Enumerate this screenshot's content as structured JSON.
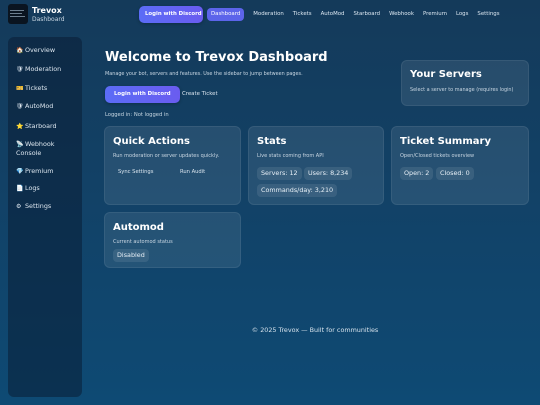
{
  "brand": {
    "title": "Trevox",
    "subtitle": "Dashboard"
  },
  "topnav": {
    "login_label": "Login with Discord",
    "links": [
      "Dashboard",
      "Moderation",
      "Tickets",
      "AutoMod",
      "Starboard",
      "Webhook",
      "Premium",
      "Logs",
      "Settings"
    ],
    "active": "Dashboard"
  },
  "sidebar": {
    "items": [
      {
        "icon": "home-icon",
        "glyph": "🏠",
        "label": "Overview"
      },
      {
        "icon": "shield-icon",
        "glyph": "🛡",
        "label": "Moderation"
      },
      {
        "icon": "ticket-icon",
        "glyph": "🎫",
        "label": "Tickets"
      },
      {
        "icon": "shield-icon",
        "glyph": "🛡",
        "label": "AutoMod"
      },
      {
        "icon": "star-icon",
        "glyph": "⭐",
        "label": "Starboard"
      },
      {
        "icon": "satellite-icon",
        "glyph": "📡",
        "label": "Webhook Console"
      },
      {
        "icon": "gem-icon",
        "glyph": "💎",
        "label": "Premium"
      },
      {
        "icon": "log-icon",
        "glyph": "📄",
        "label": "Logs"
      },
      {
        "icon": "gear-icon",
        "glyph": "⚙",
        "label": "Settings"
      }
    ]
  },
  "main": {
    "title": "Welcome to Trevox Dashboard",
    "subtitle": "Manage your bot, servers and features. Use the sidebar to jump between pages.",
    "login_label": "Login with Discord",
    "create_ticket_label": "Create Ticket",
    "login_status": "Logged in: Not logged in"
  },
  "servers_card": {
    "title": "Your Servers",
    "subtitle": "Select a server to manage (requires login)"
  },
  "quick_actions": {
    "title": "Quick Actions",
    "subtitle": "Run moderation or server updates quickly.",
    "sync_label": "Sync Settings",
    "audit_label": "Run Audit"
  },
  "stats": {
    "title": "Stats",
    "subtitle": "Live stats coming from API",
    "servers": "Servers: 12",
    "users": "Users: 8,234",
    "commands": "Commands/day: 3,210"
  },
  "ticket_summary": {
    "title": "Ticket Summary",
    "subtitle": "Open/Closed tickets overview",
    "open": "Open: 2",
    "closed": "Closed: 0"
  },
  "automod": {
    "title": "Automod",
    "subtitle": "Current automod status",
    "status": "Disabled"
  },
  "footer": {
    "text": "© 2025 Trevox — Built for communities"
  }
}
